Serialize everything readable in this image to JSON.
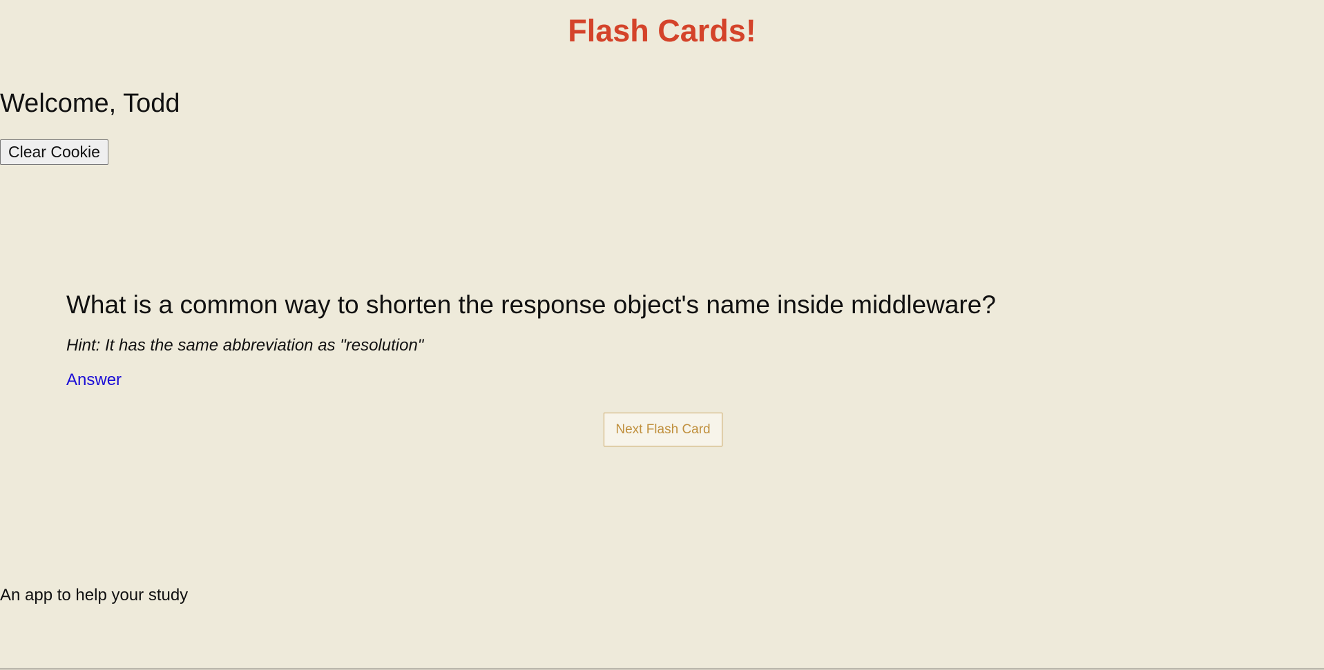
{
  "header": {
    "title": "Flash Cards!"
  },
  "user": {
    "welcome": "Welcome, Todd",
    "clear_cookie_label": "Clear Cookie"
  },
  "card": {
    "question": "What is a common way to shorten the response object's name inside middleware?",
    "hint": "Hint: It has the same abbreviation as \"resolution\"",
    "answer_label": "Answer",
    "next_label": "Next Flash Card"
  },
  "footer": {
    "tagline": "An app to help your study"
  },
  "colors": {
    "background": "#EEEADA",
    "title": "#D4432A",
    "link": "#1A0DD6",
    "next_button_accent": "#C0903E"
  }
}
